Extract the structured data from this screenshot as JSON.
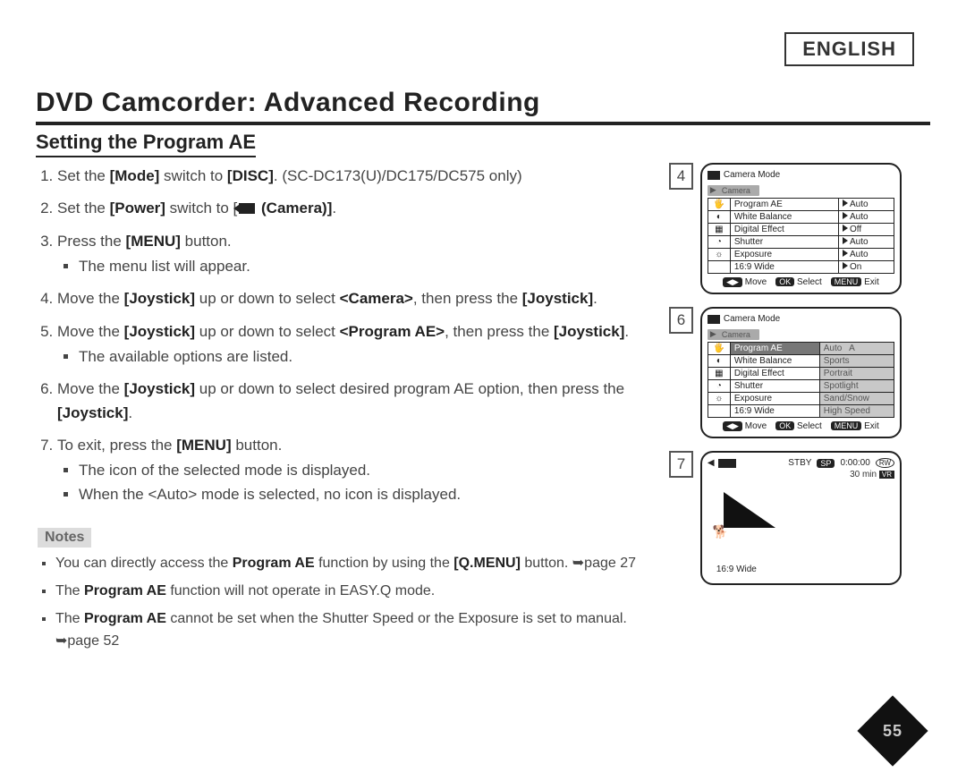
{
  "language_box": "ENGLISH",
  "title": "DVD Camcorder: Advanced Recording",
  "subheading": "Setting the Program AE",
  "steps": [
    {
      "n": "1",
      "pre": "Set the ",
      "b1": "[Mode]",
      "mid": " switch to ",
      "b2": "[DISC]",
      "post": ". (SC-DC173(U)/DC175/DC575 only)"
    },
    {
      "n": "2",
      "pre": "Set the ",
      "b1": "[Power]",
      "mid": " switch to [",
      "icon": true,
      "b2": "(Camera)]",
      "post": "."
    },
    {
      "n": "3",
      "pre": "Press the ",
      "b1": "[MENU]",
      "mid": " button.",
      "sub": [
        "The menu list will appear."
      ]
    },
    {
      "n": "4",
      "pre": "Move the ",
      "b1": "[Joystick]",
      "mid": " up or down to select ",
      "b2": "<Camera>",
      "post": ", then press the ",
      "b3": "[Joystick]",
      "post2": "."
    },
    {
      "n": "5",
      "pre": "Move the ",
      "b1": "[Joystick]",
      "mid": " up or down to select ",
      "b2": "<Program AE>",
      "post": ", then press the ",
      "b3": "[Joystick]",
      "post2": ".",
      "sub": [
        "The available options are listed."
      ]
    },
    {
      "n": "6",
      "pre": "Move the ",
      "b1": "[Joystick]",
      "mid": " up or down to select desired program AE option, then press the ",
      "b2": "[Joystick]",
      "post": "."
    },
    {
      "n": "7",
      "pre": "To exit, press the ",
      "b1": "[MENU]",
      "mid": " button.",
      "sub": [
        "The icon of the selected mode is displayed.",
        "When the <Auto> mode is selected, no icon is displayed."
      ]
    }
  ],
  "notes_label": "Notes",
  "notes": [
    {
      "pre": "You can directly access the ",
      "b1": "Program AE",
      "mid": " function by using the ",
      "b2": "[Q.MENU]",
      "post": " button. ➥page 27"
    },
    {
      "pre": "The ",
      "b1": "Program AE",
      "mid": " function will not operate in EASY.Q mode."
    },
    {
      "pre": "The ",
      "b1": "Program AE",
      "mid": " cannot be set when the Shutter Speed or the Exposure is set to manual. ➥page 52"
    }
  ],
  "shot4": {
    "num": "4",
    "title": "Camera Mode",
    "tab": "Camera",
    "rows": [
      {
        "label": "Program AE",
        "val": "Auto"
      },
      {
        "label": "White Balance",
        "val": "Auto"
      },
      {
        "label": "Digital Effect",
        "val": "Off"
      },
      {
        "label": "Shutter",
        "val": "Auto"
      },
      {
        "label": "Exposure",
        "val": "Auto"
      },
      {
        "label": "16:9 Wide",
        "val": "On"
      }
    ],
    "footer": {
      "move": "Move",
      "select": "Select",
      "exit": "Exit"
    }
  },
  "shot6": {
    "num": "6",
    "title": "Camera Mode",
    "tab": "Camera",
    "rows": [
      {
        "label": "Program AE",
        "val": "Auto",
        "sym": "A",
        "hl": true
      },
      {
        "label": "White Balance",
        "val": "Sports"
      },
      {
        "label": "Digital Effect",
        "val": "Portrait"
      },
      {
        "label": "Shutter",
        "val": "Spotlight"
      },
      {
        "label": "Exposure",
        "val": "Sand/Snow"
      },
      {
        "label": "16:9 Wide",
        "val": "High Speed"
      }
    ],
    "footer": {
      "move": "Move",
      "select": "Select",
      "exit": "Exit"
    }
  },
  "shot7": {
    "num": "7",
    "stby": "STBY",
    "sp": "SP",
    "time": "0:00:00",
    "min": "30 min",
    "wide": "16:9 Wide",
    "rw": "RW",
    "vr": "VR"
  },
  "page_number": "55"
}
